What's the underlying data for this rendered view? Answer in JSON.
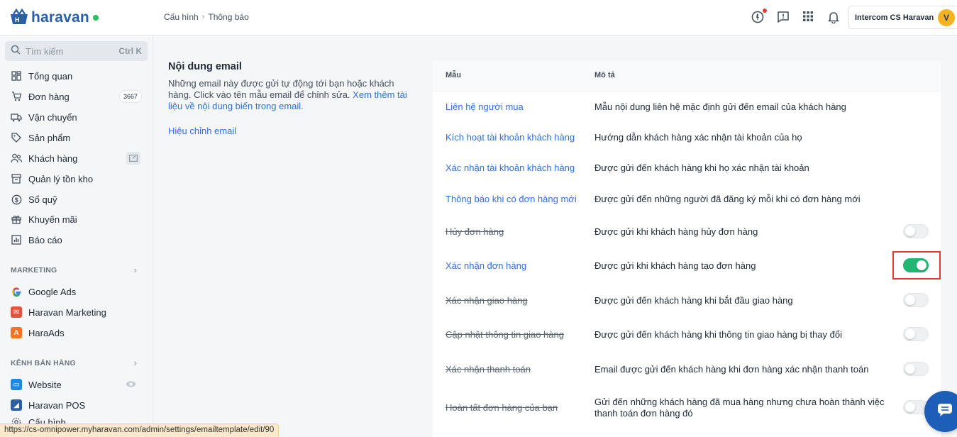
{
  "brand": {
    "name": "haravan",
    "status_color": "#22c55e",
    "brand_color": "#2b5fa8"
  },
  "breadcrumb": {
    "parent": "Cấu hình",
    "current": "Thông báo"
  },
  "topbar": {
    "user_name": "Intercom CS Haravan",
    "avatar_initial": "V"
  },
  "search": {
    "placeholder": "Tìm kiếm",
    "shortcut": "Ctrl K"
  },
  "sidebar": {
    "items": [
      {
        "label": "Tổng quan",
        "icon": "dashboard-icon"
      },
      {
        "label": "Đơn hàng",
        "icon": "cart-icon",
        "badge": "3667"
      },
      {
        "label": "Vận chuyển",
        "icon": "truck-icon"
      },
      {
        "label": "Sản phẩm",
        "icon": "tag-icon"
      },
      {
        "label": "Khách hàng",
        "icon": "users-icon"
      },
      {
        "label": "Quản lý tồn kho",
        "icon": "inventory-icon"
      },
      {
        "label": "Sổ quỹ",
        "icon": "cash-icon"
      },
      {
        "label": "Khuyến mãi",
        "icon": "gift-icon"
      },
      {
        "label": "Báo cáo",
        "icon": "chart-icon"
      }
    ],
    "marketing_label": "MARKETING",
    "marketing_items": [
      {
        "label": "Google Ads",
        "icon": "google-icon"
      },
      {
        "label": "Haravan Marketing",
        "icon": "haravan-marketing-icon"
      },
      {
        "label": "HaraAds",
        "icon": "haraads-icon"
      }
    ],
    "channels_label": "KÊNH BÁN HÀNG",
    "channel_items": [
      {
        "label": "Website",
        "icon": "website-icon"
      },
      {
        "label": "Haravan POS",
        "icon": "pos-icon"
      },
      {
        "label": "Cấu hình",
        "icon": "settings-icon"
      }
    ]
  },
  "status_url": "https://cs-omnipower.myharavan.com/admin/settings/emailtemplate/edit/90",
  "content": {
    "title": "Nội dung email",
    "description": "Những email này được gửi tự động tới bạn hoặc khách hàng. Click vào tên mẫu email để chỉnh sửa. ",
    "doc_link": "Xem thêm tài liệu về nội dung biến trong email.",
    "edit_link": "Hiệu chỉnh email"
  },
  "table": {
    "col_template": "Mẫu",
    "col_description": "Mô tả",
    "rows": [
      {
        "name": "Liên hệ người mua",
        "desc": "Mẫu nội dung liên hệ mặc định gửi đến email của khách hàng",
        "toggle": null
      },
      {
        "name": "Kích hoạt tài khoản khách hàng",
        "desc": "Hướng dẫn khách hàng xác nhận tài khoản của họ",
        "toggle": null
      },
      {
        "name": "Xác nhận tài khoản khách hàng",
        "desc": "Được gửi đến khách hàng khi họ xác nhận tài khoản",
        "toggle": null
      },
      {
        "name": "Thông báo khi có đơn hàng mới",
        "desc": "Được gửi đến những người đã đăng ký mỗi khi có đơn hàng mới",
        "toggle": null
      },
      {
        "name": "Hủy đơn hàng",
        "desc": "Được gửi khi khách hàng hủy đơn hàng",
        "toggle": false
      },
      {
        "name": "Xác nhận đơn hàng",
        "desc": "Được gửi khi khách hàng tạo đơn hàng",
        "toggle": true
      },
      {
        "name": "Xác nhận giao hàng",
        "desc": "Được gửi đến khách hàng khi bắt đầu giao hàng",
        "toggle": false
      },
      {
        "name": "Cập nhật thông tin giao hàng",
        "desc": "Được gửi đến khách hàng khi thông tin giao hàng bị thay đổi",
        "toggle": false
      },
      {
        "name": "Xác nhận thanh toán",
        "desc": "Email được gửi đến khách hàng khi đơn hàng xác nhận thanh toán",
        "toggle": false
      },
      {
        "name": "Hoàn tất đơn hàng của bạn",
        "desc": "Gửi đến những khách hàng đã mua hàng nhưng chưa hoàn thành việc thanh toán đơn hàng đó",
        "toggle": false
      }
    ]
  },
  "colors": {
    "link": "#2e6fe3",
    "toggle_on": "#22b573",
    "highlight": "#e53935"
  }
}
